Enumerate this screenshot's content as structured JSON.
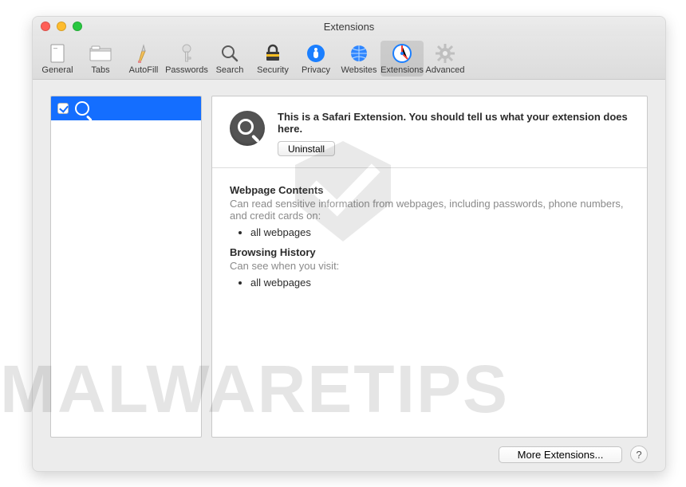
{
  "window": {
    "title": "Extensions"
  },
  "toolbar": {
    "items": [
      {
        "label": "General"
      },
      {
        "label": "Tabs"
      },
      {
        "label": "AutoFill"
      },
      {
        "label": "Passwords"
      },
      {
        "label": "Search"
      },
      {
        "label": "Security"
      },
      {
        "label": "Privacy"
      },
      {
        "label": "Websites"
      },
      {
        "label": "Extensions"
      },
      {
        "label": "Advanced"
      }
    ]
  },
  "extension": {
    "description": "This is a Safari Extension. You should tell us what your extension does here.",
    "uninstall_label": "Uninstall"
  },
  "permissions": {
    "section1_title": "Webpage Contents",
    "section1_desc": "Can read sensitive information from webpages, including passwords, phone numbers, and credit cards on:",
    "section1_item": "all webpages",
    "section2_title": "Browsing History",
    "section2_desc": "Can see when you visit:",
    "section2_item": "all webpages"
  },
  "footer": {
    "more_label": "More Extensions...",
    "help_label": "?"
  },
  "watermark": "MALWARETIPS"
}
